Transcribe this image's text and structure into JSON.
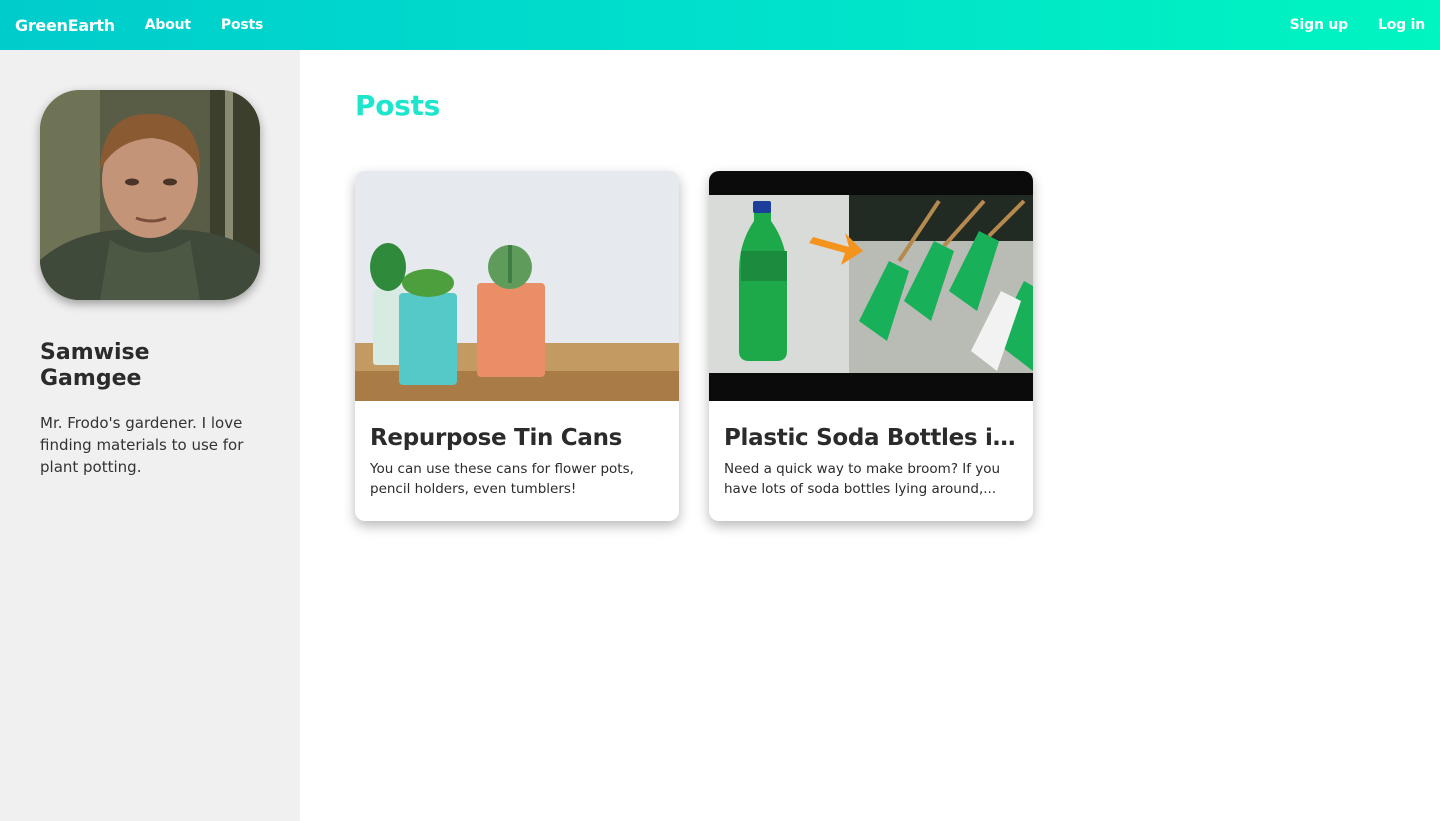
{
  "nav": {
    "brand": "GreenEarth",
    "links": [
      {
        "label": "About"
      },
      {
        "label": "Posts"
      }
    ],
    "auth": [
      {
        "label": "Sign up"
      },
      {
        "label": "Log in"
      }
    ]
  },
  "profile": {
    "name": "Samwise Gamgee",
    "bio": "Mr. Frodo's gardener. I love finding materials to use for plant potting."
  },
  "main": {
    "title": "Posts",
    "posts": [
      {
        "title": "Repurpose Tin Cans",
        "excerpt": "You can use these cans for flower pots, pencil holders, even tumblers!"
      },
      {
        "title": "Plastic Soda Bottles int...",
        "excerpt": "Need a quick way to make broom? If you have lots of soda bottles lying around,..."
      }
    ]
  },
  "colors": {
    "nav_gradient_start": "#00cccc",
    "nav_gradient_end": "#00f5c0",
    "accent": "#1ee6cc",
    "sidebar_bg": "#f0f0f0"
  }
}
